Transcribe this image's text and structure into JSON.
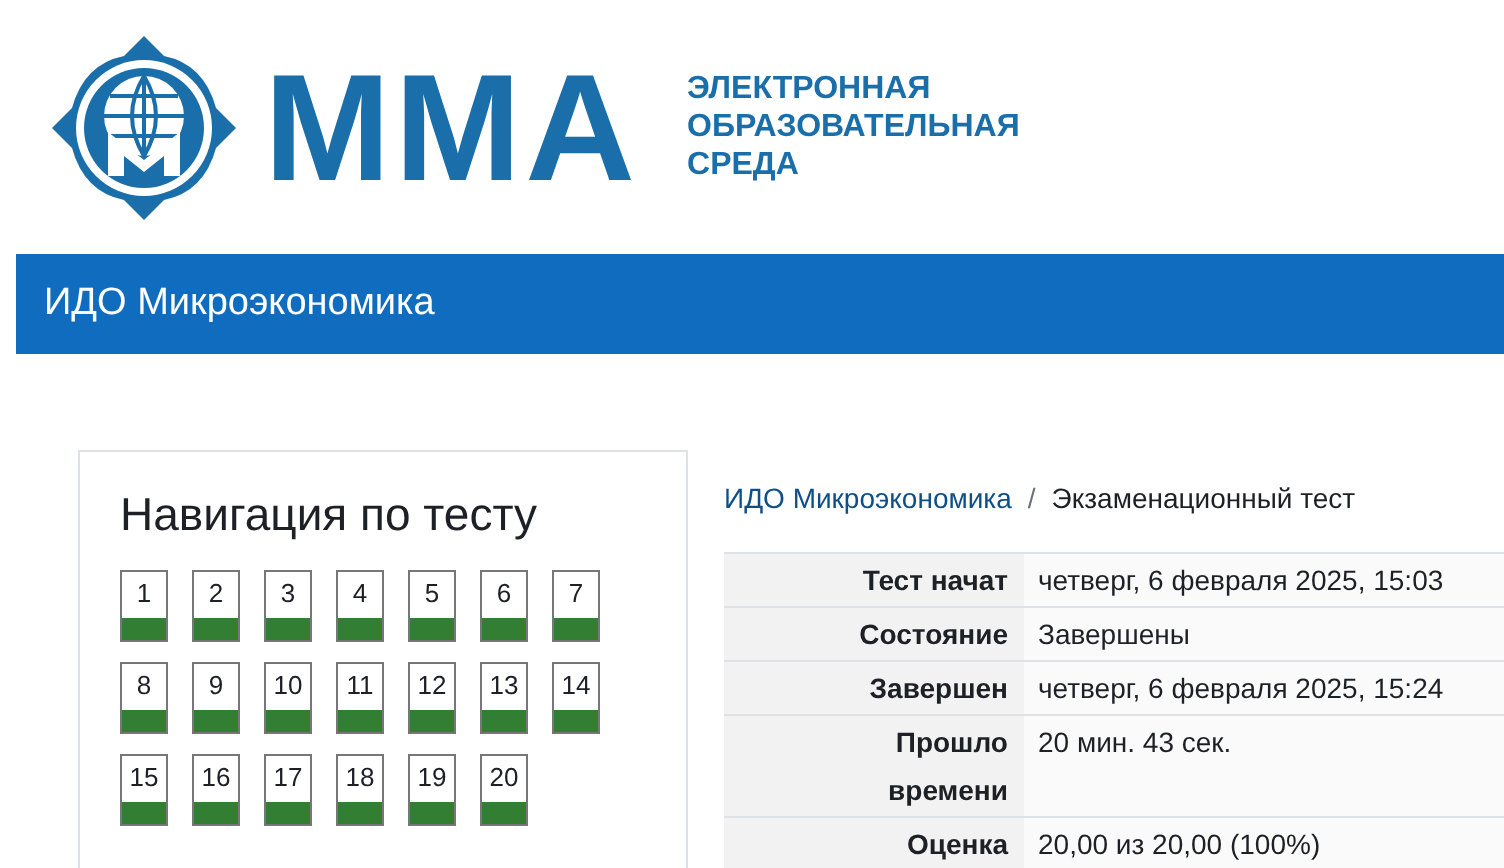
{
  "logo": {
    "wordmark": "ММА",
    "subtitle": [
      "ЭЛЕКТРОННАЯ",
      "ОБРАЗОВАТЕЛЬНАЯ",
      "СРЕДА"
    ]
  },
  "header": {
    "title": "ИДО Микроэкономика"
  },
  "navigation": {
    "title": "Навигация по тесту",
    "questions": [
      {
        "label": "1",
        "correct": true
      },
      {
        "label": "2",
        "correct": true
      },
      {
        "label": "3",
        "correct": true
      },
      {
        "label": "4",
        "correct": true
      },
      {
        "label": "5",
        "correct": true
      },
      {
        "label": "6",
        "correct": true
      },
      {
        "label": "7",
        "correct": true
      },
      {
        "label": "8",
        "correct": true
      },
      {
        "label": "9",
        "correct": true
      },
      {
        "label": "10",
        "correct": true
      },
      {
        "label": "11",
        "correct": true
      },
      {
        "label": "12",
        "correct": true
      },
      {
        "label": "13",
        "correct": true
      },
      {
        "label": "14",
        "correct": true
      },
      {
        "label": "15",
        "correct": true
      },
      {
        "label": "16",
        "correct": true
      },
      {
        "label": "17",
        "correct": true
      },
      {
        "label": "18",
        "correct": true
      },
      {
        "label": "19",
        "correct": true
      },
      {
        "label": "20",
        "correct": true
      }
    ]
  },
  "breadcrumb": {
    "items": [
      "ИДО Микроэкономика",
      "Экзаменационный тест"
    ],
    "separator": "/"
  },
  "summary": [
    {
      "label": "Тест начат",
      "value": "четверг, 6 февраля 2025, 15:03"
    },
    {
      "label": "Состояние",
      "value": "Завершены"
    },
    {
      "label": "Завершен",
      "value": "четверг, 6 февраля 2025, 15:24"
    },
    {
      "label": "Прошло времени",
      "value": "20 мин. 43 сек."
    },
    {
      "label": "Оценка",
      "value": "20,00 из 20,00 (100%)"
    }
  ]
}
